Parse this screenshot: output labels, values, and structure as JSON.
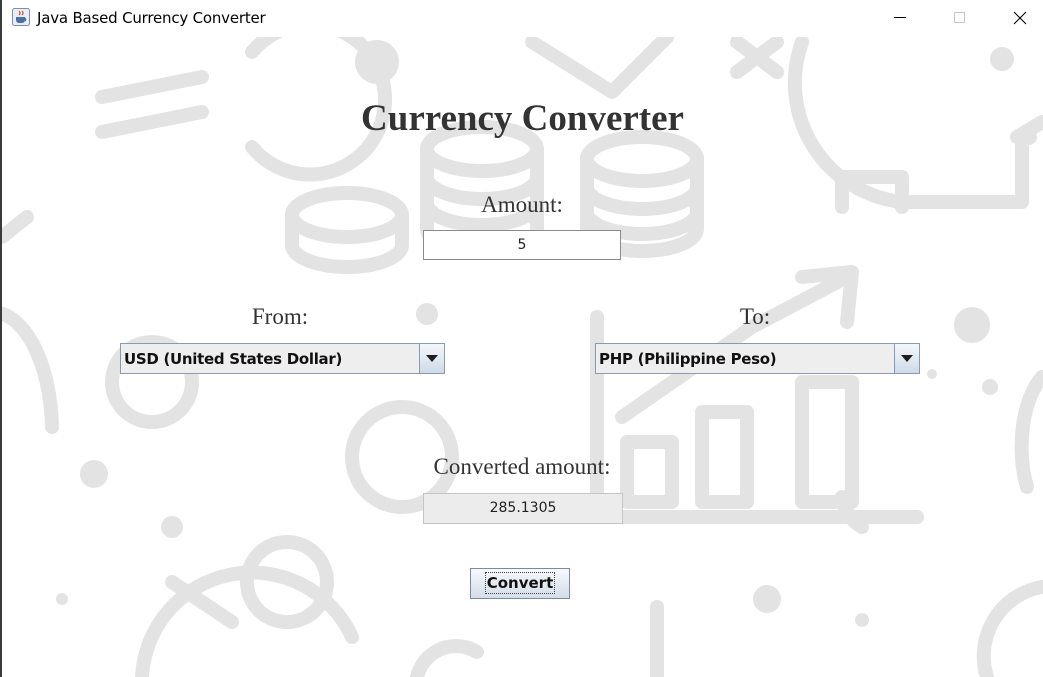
{
  "window": {
    "title": "Java Based Currency Converter"
  },
  "heading": "Currency Converter",
  "amount": {
    "label": "Amount:",
    "value": "5"
  },
  "from": {
    "label": "From:",
    "selected": "USD (United States Dollar)"
  },
  "to": {
    "label": "To:",
    "selected": "PHP (Philippine Peso)"
  },
  "converted": {
    "label": "Converted amount:",
    "value": "285.1305"
  },
  "convert_button": "Convert",
  "icons": {
    "app": "java-cup-icon",
    "minimize": "minimize-icon",
    "maximize": "maximize-icon",
    "close": "close-icon",
    "dropdown": "triangle-down-icon"
  },
  "colors": {
    "background": "#ffffff",
    "doodle": "#e3e3e3",
    "text": "#333333",
    "border": "#8a9bb0"
  }
}
